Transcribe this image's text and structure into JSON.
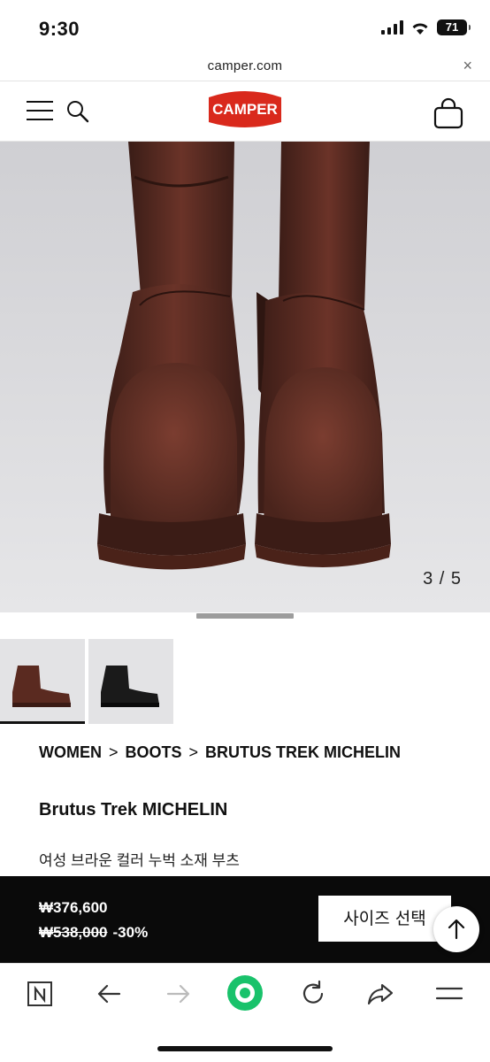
{
  "status_bar": {
    "time": "9:30",
    "battery": "71"
  },
  "browser": {
    "url": "camper.com",
    "close_icon": "×"
  },
  "header": {
    "logo_text": "CAMPER",
    "brand_color": "#d9291c"
  },
  "hero": {
    "image_counter": "3 / 5",
    "description": "brown leather boots front view"
  },
  "thumbnails": [
    {
      "color": "brown",
      "selected": true
    },
    {
      "color": "black",
      "selected": false
    }
  ],
  "breadcrumb": {
    "items": [
      "WOMEN",
      "BOOTS",
      "BRUTUS TREK MICHELIN"
    ],
    "separator": ">"
  },
  "product": {
    "name": "Brutus Trek MICHELIN",
    "description": "여성 브라운 컬러 누벅 소재 부츠"
  },
  "price": {
    "current": "₩376,600",
    "original": "₩538,000",
    "discount": "-30%"
  },
  "actions": {
    "size_button": "사이즈 선택"
  },
  "colors": {
    "price_bar": "#0a0a0a",
    "accent_green": "#19c26b"
  }
}
